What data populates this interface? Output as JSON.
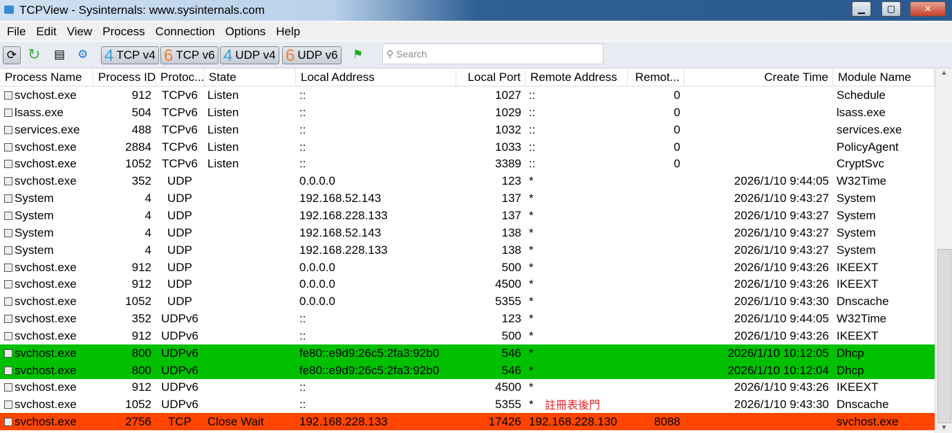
{
  "window": {
    "title": "TCPView - Sysinternals: www.sysinternals.com"
  },
  "menu": [
    "File",
    "Edit",
    "View",
    "Process",
    "Connection",
    "Options",
    "Help"
  ],
  "toolbar": {
    "tcp4": {
      "num": "4",
      "label": "TCP v4"
    },
    "tcp6": {
      "num": "6",
      "label": "TCP v6"
    },
    "udp4": {
      "num": "4",
      "label": "UDP v4"
    },
    "udp6": {
      "num": "6",
      "label": "UDP v6"
    },
    "search_placeholder": "Search"
  },
  "columns": [
    "Process Name",
    "Process ID",
    "Protoc...",
    "State",
    "Local Address",
    "Local Port",
    "Remote Address",
    "Remot...",
    "Create Time",
    "Module Name"
  ],
  "rows": [
    [
      "svchost.exe",
      "912",
      "TCPv6",
      "Listen",
      "::",
      "1027",
      "::",
      "0",
      "",
      "Schedule"
    ],
    [
      "lsass.exe",
      "504",
      "TCPv6",
      "Listen",
      "::",
      "1029",
      "::",
      "0",
      "",
      "lsass.exe"
    ],
    [
      "services.exe",
      "488",
      "TCPv6",
      "Listen",
      "::",
      "1032",
      "::",
      "0",
      "",
      "services.exe"
    ],
    [
      "svchost.exe",
      "2884",
      "TCPv6",
      "Listen",
      "::",
      "1033",
      "::",
      "0",
      "",
      "PolicyAgent"
    ],
    [
      "svchost.exe",
      "1052",
      "TCPv6",
      "Listen",
      "::",
      "3389",
      "::",
      "0",
      "",
      "CryptSvc"
    ],
    [
      "svchost.exe",
      "352",
      "UDP",
      "",
      "0.0.0.0",
      "123",
      "*",
      "",
      "2026/1/10 9:44:05",
      "W32Time"
    ],
    [
      "System",
      "4",
      "UDP",
      "",
      "192.168.52.143",
      "137",
      "*",
      "",
      "2026/1/10 9:43:27",
      "System"
    ],
    [
      "System",
      "4",
      "UDP",
      "",
      "192.168.228.133",
      "137",
      "*",
      "",
      "2026/1/10 9:43:27",
      "System"
    ],
    [
      "System",
      "4",
      "UDP",
      "",
      "192.168.52.143",
      "138",
      "*",
      "",
      "2026/1/10 9:43:27",
      "System"
    ],
    [
      "System",
      "4",
      "UDP",
      "",
      "192.168.228.133",
      "138",
      "*",
      "",
      "2026/1/10 9:43:27",
      "System"
    ],
    [
      "svchost.exe",
      "912",
      "UDP",
      "",
      "0.0.0.0",
      "500",
      "*",
      "",
      "2026/1/10 9:43:26",
      "IKEEXT"
    ],
    [
      "svchost.exe",
      "912",
      "UDP",
      "",
      "0.0.0.0",
      "4500",
      "*",
      "",
      "2026/1/10 9:43:26",
      "IKEEXT"
    ],
    [
      "svchost.exe",
      "1052",
      "UDP",
      "",
      "0.0.0.0",
      "5355",
      "*",
      "",
      "2026/1/10 9:43:30",
      "Dnscache"
    ],
    [
      "svchost.exe",
      "352",
      "UDPv6",
      "",
      "::",
      "123",
      "*",
      "",
      "2026/1/10 9:44:05",
      "W32Time"
    ],
    [
      "svchost.exe",
      "912",
      "UDPv6",
      "",
      "::",
      "500",
      "*",
      "",
      "2026/1/10 9:43:26",
      "IKEEXT"
    ],
    [
      "svchost.exe",
      "800",
      "UDPv6",
      "",
      "fe80::e9d9:26c5:2fa3:92b0",
      "546",
      "*",
      "",
      "2026/1/10 10:12:05",
      "Dhcp"
    ],
    [
      "svchost.exe",
      "800",
      "UDPv6",
      "",
      "fe80::e9d9:26c5:2fa3:92b0",
      "546",
      "*",
      "",
      "2026/1/10 10:12:04",
      "Dhcp"
    ],
    [
      "svchost.exe",
      "912",
      "UDPv6",
      "",
      "::",
      "4500",
      "*",
      "",
      "2026/1/10 9:43:26",
      "IKEEXT"
    ],
    [
      "svchost.exe",
      "1052",
      "UDPv6",
      "",
      "::",
      "5355",
      "*",
      "",
      "2026/1/10 9:43:30",
      "Dnscache"
    ],
    [
      "svchost.exe",
      "2756",
      "TCP",
      "Close Wait",
      "192.168.228.133",
      "17426",
      "192.168.228.130",
      "8088",
      "",
      "svchost.exe"
    ]
  ],
  "row_highlight": {
    "15": "green",
    "16": "green",
    "19": "orange"
  },
  "annotation": "註冊表後門",
  "colors": {
    "new": "#00c000",
    "closing": "#ff4500",
    "annotation": "#e0262a"
  }
}
